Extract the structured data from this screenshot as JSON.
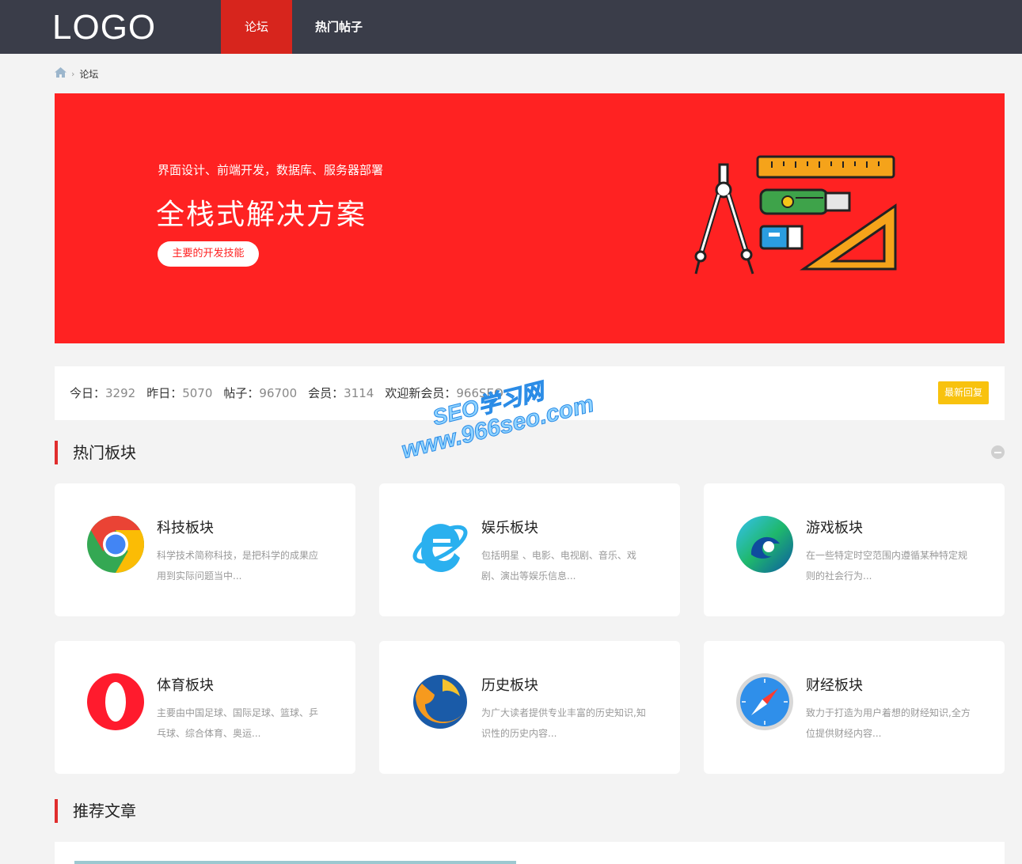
{
  "header": {
    "logo": "LOGO",
    "nav": [
      {
        "label": "论坛",
        "active": true
      },
      {
        "label": "热门帖子",
        "active": false
      }
    ]
  },
  "breadcrumb": {
    "home_icon": "home-icon",
    "current": "论坛"
  },
  "banner": {
    "subtitle": "界面设计、前端开发，数据库、服务器部署",
    "title": "全栈式解决方案",
    "button": "主要的开发技能",
    "background": "#ff2222"
  },
  "stats": {
    "items": [
      {
        "label": "今日：",
        "value": "3292"
      },
      {
        "label": "昨日：",
        "value": "5070"
      },
      {
        "label": "帖子：",
        "value": "96700"
      },
      {
        "label": "会员：",
        "value": "3114"
      },
      {
        "label": "欢迎新会员：",
        "value": "966SEO"
      }
    ],
    "latest_button": "最新回复"
  },
  "watermark": {
    "line1": "SEO学习网",
    "line2": "www.966seo.com"
  },
  "sections": {
    "hot": "热门板块",
    "recommended": "推荐文章"
  },
  "boards": [
    {
      "name": "科技板块",
      "desc": "科学技术简称科技，是把科学的成果应用到实际问题当中...",
      "icon": "chrome-icon"
    },
    {
      "name": "娱乐板块",
      "desc": "包括明星 、电影、电视剧、音乐、戏剧、演出等娱乐信息...",
      "icon": "ie-icon"
    },
    {
      "name": "游戏板块",
      "desc": "在一些特定时空范围内遵循某种特定规则的社会行为...",
      "icon": "edge-icon"
    },
    {
      "name": "体育板块",
      "desc": "主要由中国足球、国际足球、篮球、乒乓球、综合体育、奥运...",
      "icon": "opera-icon"
    },
    {
      "name": "历史板块",
      "desc": "为广大读者提供专业丰富的历史知识,知识性的历史内容...",
      "icon": "firefox-icon"
    },
    {
      "name": "财经板块",
      "desc": "致力于打造为用户着想的财经知识,全方位提供财经内容...",
      "icon": "safari-icon"
    }
  ],
  "colors": {
    "header": "#3a3d49",
    "accent": "#d7251d",
    "latest_button": "#f8c20e"
  }
}
